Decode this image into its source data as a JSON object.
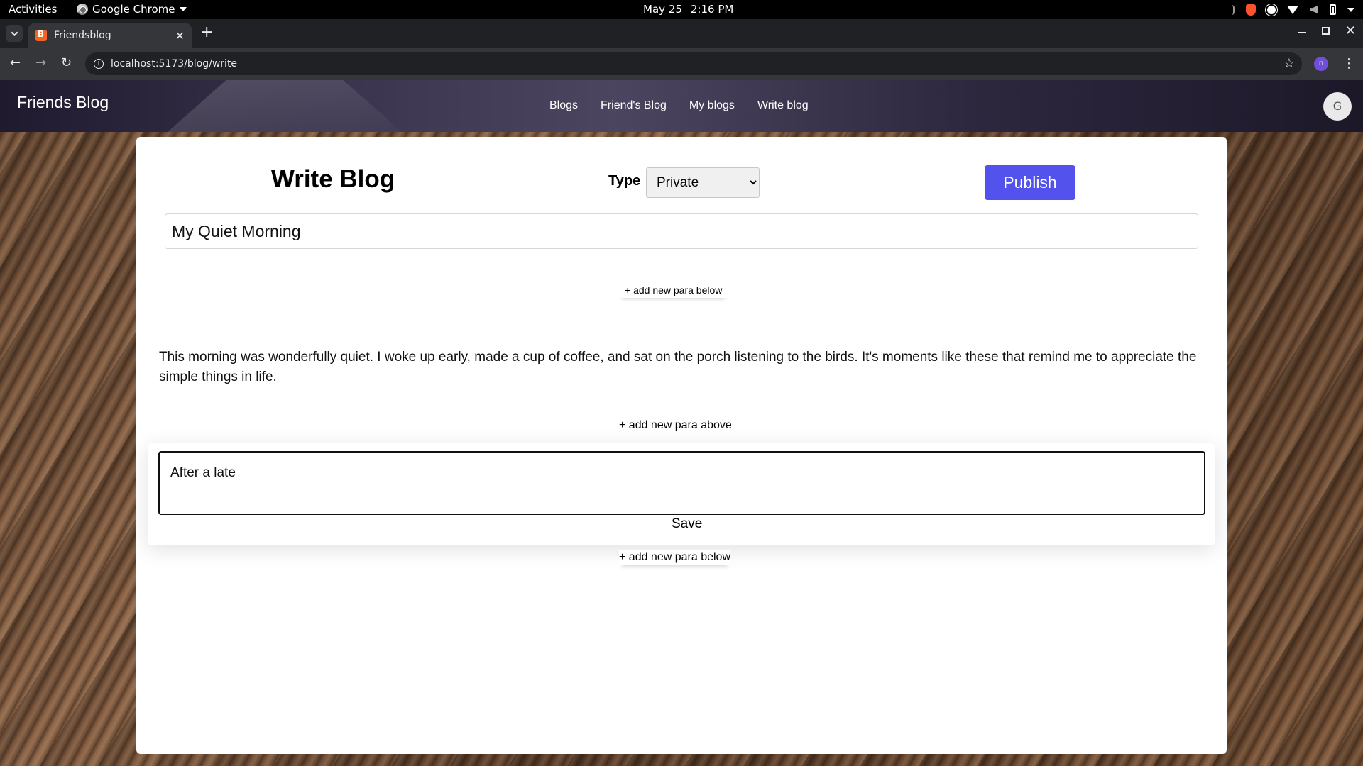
{
  "os_bar": {
    "activities": "Activities",
    "app_name": "Google Chrome",
    "date": "May 25",
    "time": "2:16 PM"
  },
  "browser": {
    "tab_title": "Friendsblog",
    "url": "localhost:5173/blog/write",
    "profile_initial": "n"
  },
  "site": {
    "brand": "Friends Blog",
    "nav": [
      "Blogs",
      "Friend's Blog",
      "My blogs",
      "Write blog"
    ],
    "avatar_initial": "G"
  },
  "editor": {
    "heading": "Write Blog",
    "type_label": "Type",
    "type_options": [
      "Private"
    ],
    "type_selected": "Private",
    "publish_label": "Publish",
    "title_value": "My Quiet Morning",
    "add_below_label": "+ add new para below",
    "add_above_label": "+ add new para above",
    "paragraph_text": "This morning was wonderfully quiet. I woke up early, made a cup of coffee, and sat on the porch listening to the birds. It's moments like these that remind me to appreciate the simple things in life.",
    "draft_text": "After a late ",
    "save_label": "Save"
  },
  "colors": {
    "publish_bg": "#5352ed",
    "chrome_toolbar": "#35363a",
    "chrome_tabstrip": "#202124"
  }
}
